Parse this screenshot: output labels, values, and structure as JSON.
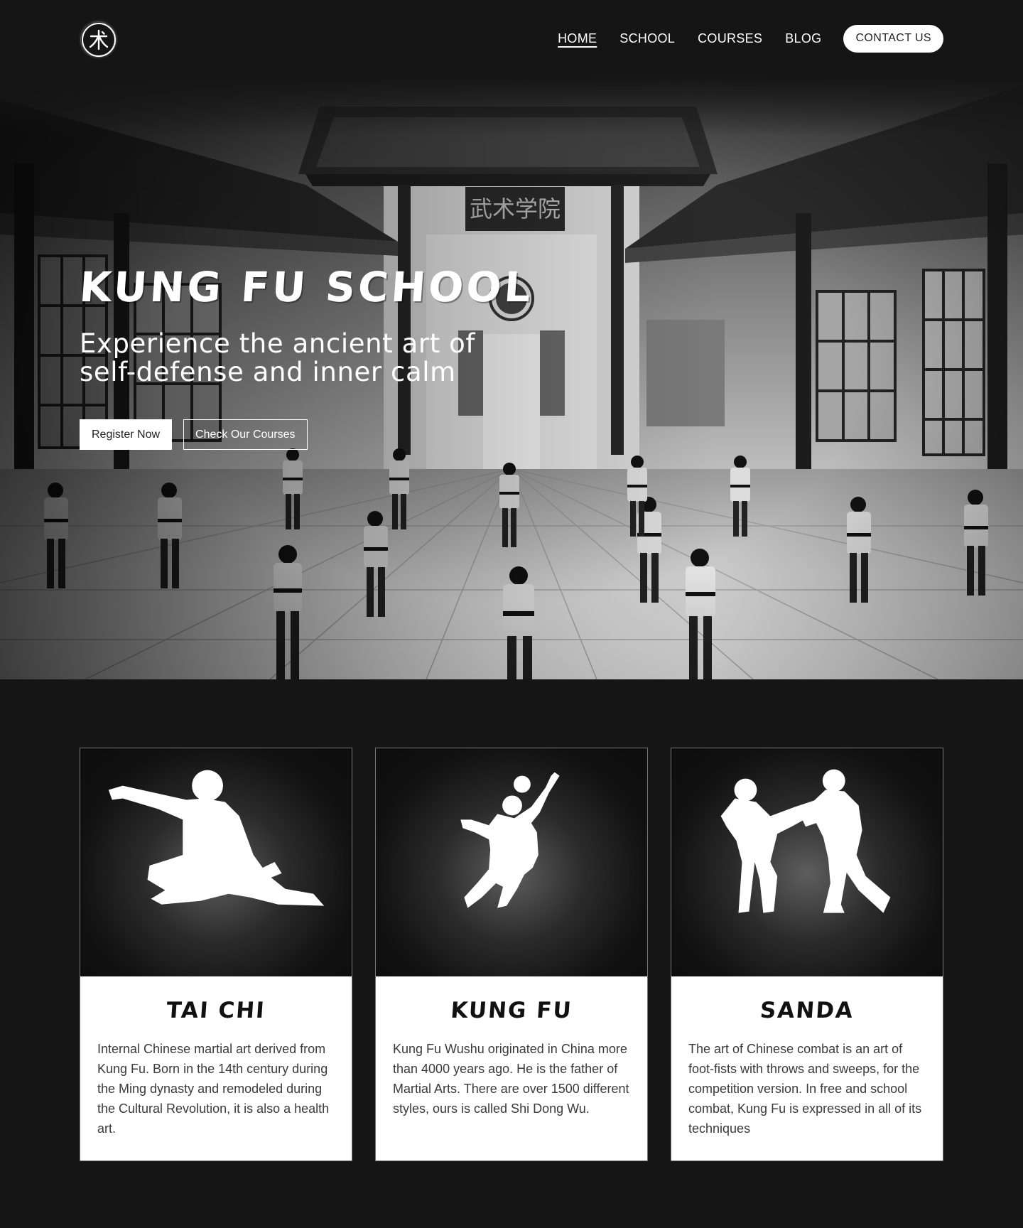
{
  "header": {
    "logo_icon": "kung-fu-character-logo",
    "nav": [
      {
        "label": "HOME",
        "active": true
      },
      {
        "label": "SCHOOL",
        "active": false
      },
      {
        "label": "COURSES",
        "active": false
      },
      {
        "label": "BLOG",
        "active": false
      }
    ],
    "contact_label": "CONTACT US"
  },
  "hero": {
    "title": "KUNG FU SCHOOL",
    "subtitle": "Experience the ancient art of self-defense and inner calm",
    "register_label": "Register Now",
    "courses_label": "Check Our Courses",
    "image": "martial-arts-hall-photo"
  },
  "cards": [
    {
      "title": "TAI CHI",
      "icon": "tai-chi-silhouette",
      "text": "Internal Chinese martial art derived from Kung Fu. Born in the 14th century during the Ming dynasty and remodeled during the Cultural Revolution, it is also a health art."
    },
    {
      "title": "KUNG FU",
      "icon": "kung-fu-silhouette",
      "text": "Kung Fu Wushu originated in China more than 4000 years ago. He is the father of Martial Arts. There are over 1500 different styles, ours is called Shi Dong Wu."
    },
    {
      "title": "SANDA",
      "icon": "sanda-silhouette",
      "text": "The art of Chinese combat is an art of foot-fists with throws and sweeps, for the competition version. In free and school combat, Kung Fu is expressed in all of its techniques"
    }
  ],
  "colors": {
    "background": "#151516",
    "card_bg": "#ffffff",
    "text_dark": "#3a3a3a"
  }
}
